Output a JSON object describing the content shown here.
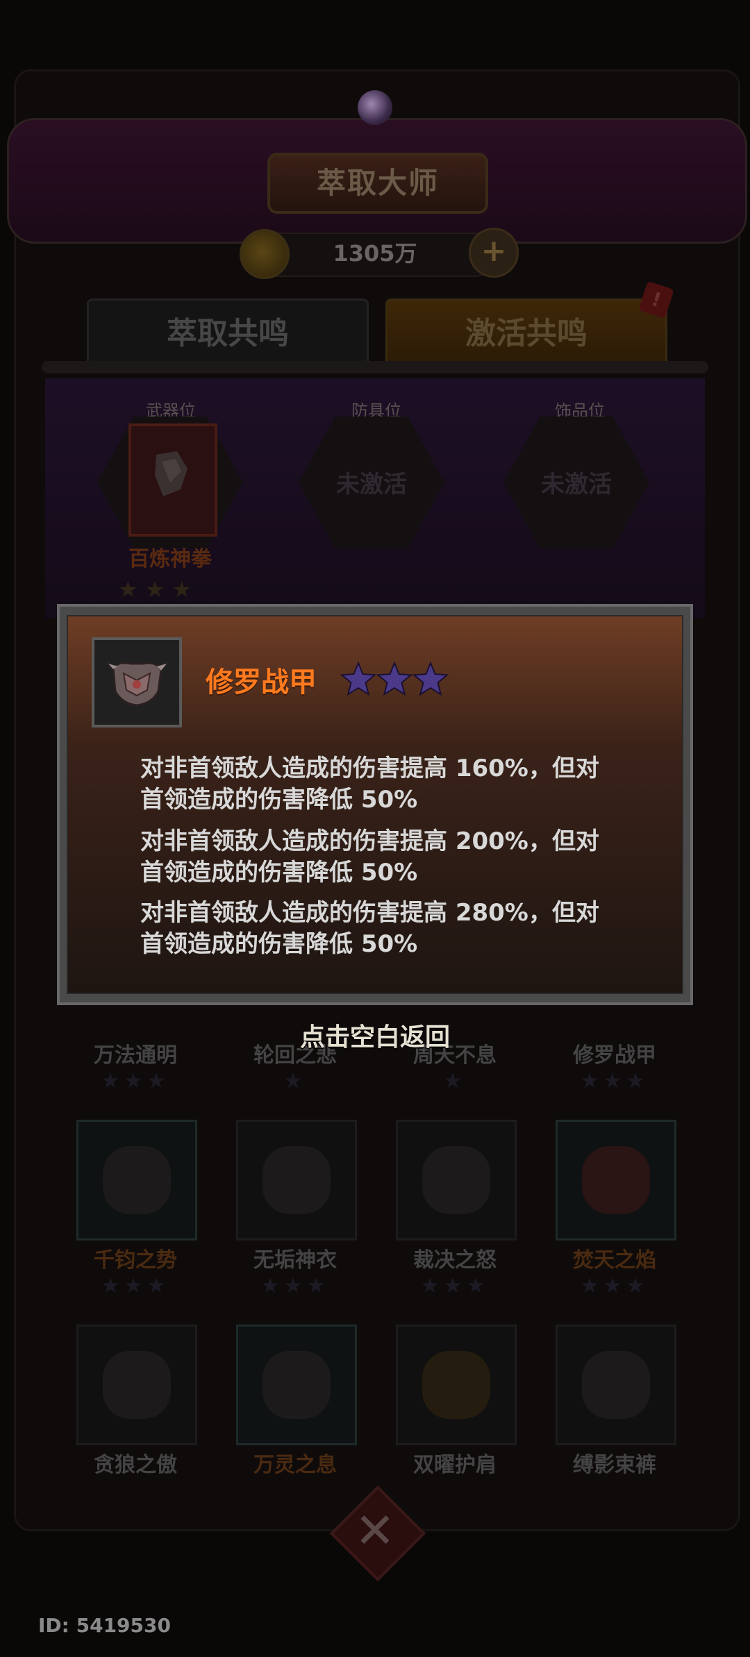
{
  "header": {
    "title": "萃取大师",
    "currency_amount": "1305万"
  },
  "tabs": [
    {
      "label": "萃取共鸣"
    },
    {
      "label": "激活共鸣"
    }
  ],
  "tab_badge": "!",
  "slots": [
    {
      "label": "武器位",
      "item_name": "百炼神拳"
    },
    {
      "label": "防具位",
      "status": "未激活"
    },
    {
      "label": "饰品位",
      "status": "未激活"
    }
  ],
  "grid": {
    "row1": [
      "万法通明",
      "轮回之悲",
      "周天不息",
      "修罗战甲"
    ],
    "row2": [
      "千钧之势",
      "无垢神衣",
      "裁决之怒",
      "焚天之焰"
    ],
    "row3": [
      "贪狼之傲",
      "万灵之息",
      "双曜护肩",
      "缚影束裤"
    ]
  },
  "popup": {
    "title": "修罗战甲",
    "stars": 3,
    "descriptions": [
      {
        "line1": "对非首领敌人造成的伤害提高 160%，但对",
        "line2": "首领造成的伤害降低 50%"
      },
      {
        "line1": "对非首领敌人造成的伤害提高 200%，但对",
        "line2": "首领造成的伤害降低 50%"
      },
      {
        "line1": "对非首领敌人造成的伤害提高 280%，但对",
        "line2": "首领造成的伤害降低 50%"
      }
    ],
    "return_hint": "点击空白返回"
  },
  "close_label": "✕",
  "user_id": "ID: 5419530",
  "colors": {
    "popup_title": "#ff7a1e",
    "star": "#4b3a8a",
    "overlay": "#0a0707"
  }
}
